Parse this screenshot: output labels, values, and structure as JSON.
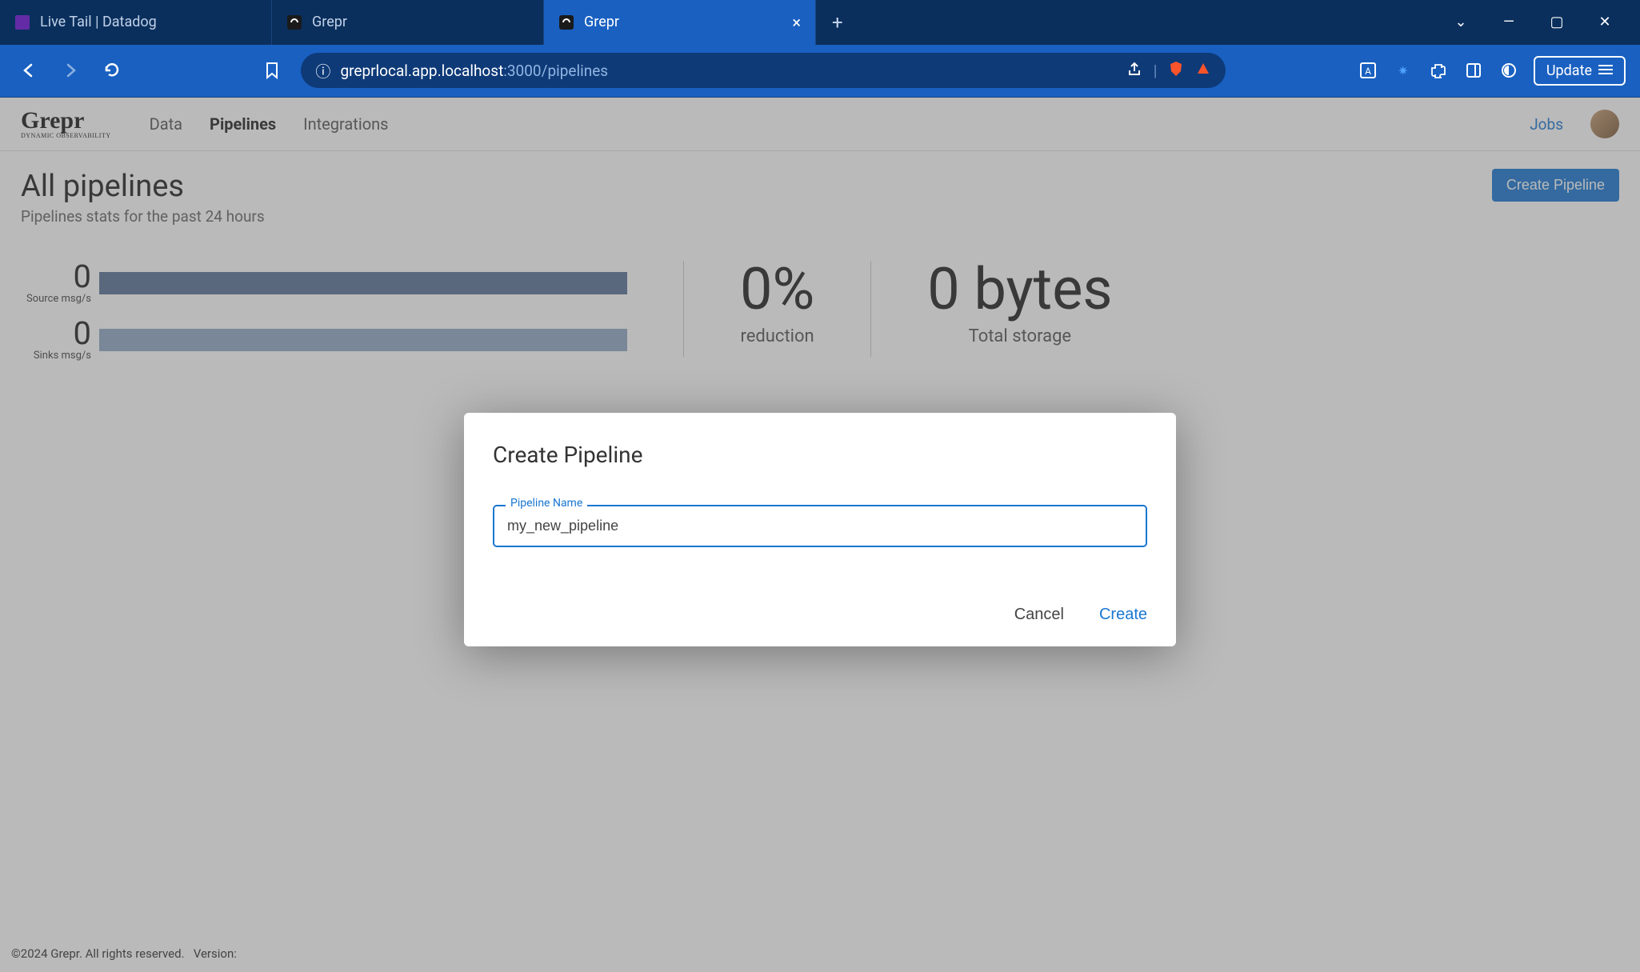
{
  "browser": {
    "tabs": [
      {
        "title": "Live Tail | Datadog"
      },
      {
        "title": "Grepr"
      },
      {
        "title": "Grepr"
      }
    ],
    "address": {
      "host": "greprlocal.app.localhost",
      "port": ":3000",
      "path": "/pipelines"
    },
    "update_label": "Update"
  },
  "header": {
    "logo": "Grepr",
    "logo_sub": "DYNAMIC OBSERVABILITY",
    "nav": {
      "data": "Data",
      "pipelines": "Pipelines",
      "integrations": "Integrations"
    },
    "jobs": "Jobs"
  },
  "page": {
    "title": "All pipelines",
    "subtitle": "Pipelines stats for the past 24 hours",
    "create_btn": "Create Pipeline"
  },
  "stats": {
    "source": {
      "value": "0",
      "label": "Source msg/s"
    },
    "sinks": {
      "value": "0",
      "label": "Sinks msg/s"
    },
    "reduction": {
      "value": "0%",
      "label": "reduction"
    },
    "storage": {
      "value": "0 bytes",
      "label": "Total storage"
    }
  },
  "footer": {
    "copyright": "©2024 Grepr. All rights reserved.",
    "version_label": "Version:"
  },
  "modal": {
    "title": "Create Pipeline",
    "field_label": "Pipeline Name",
    "field_value": "my_new_pipeline",
    "cancel": "Cancel",
    "create": "Create"
  }
}
